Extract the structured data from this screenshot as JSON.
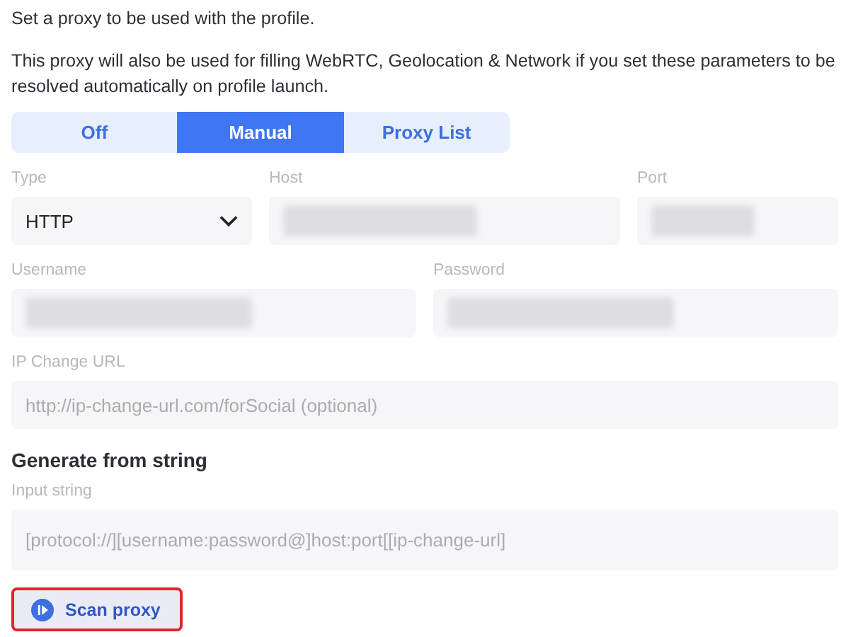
{
  "intro": [
    "Set a proxy to be used with the profile.",
    "This proxy will also be used for filling WebRTC, Geolocation & Network if you set these parameters to be resolved automatically on profile launch."
  ],
  "tabs": [
    {
      "label": "Off",
      "selected": false
    },
    {
      "label": "Manual",
      "selected": true
    },
    {
      "label": "Proxy List",
      "selected": false
    }
  ],
  "field_rows": [
    {
      "fields": [
        {
          "kind": "select",
          "label": "Type",
          "value": "HTTP"
        },
        {
          "kind": "text",
          "label": "Host",
          "redacted": true
        },
        {
          "kind": "text",
          "label": "Port",
          "redacted": true
        }
      ]
    },
    {
      "fields": [
        {
          "kind": "text",
          "label": "Username",
          "redacted": true
        },
        {
          "kind": "text",
          "label": "Password",
          "redacted": true
        }
      ]
    },
    {
      "fields": [
        {
          "kind": "text",
          "label": "IP Change URL",
          "placeholder": "http://ip-change-url.com/forSocial (optional)"
        }
      ]
    }
  ],
  "generate": {
    "heading": "Generate from string",
    "label": "Input string",
    "placeholder": "[protocol://][username:password@]host:port[[ip-change-url]"
  },
  "scan_button": {
    "label": "Scan proxy",
    "highlighted": true
  }
}
